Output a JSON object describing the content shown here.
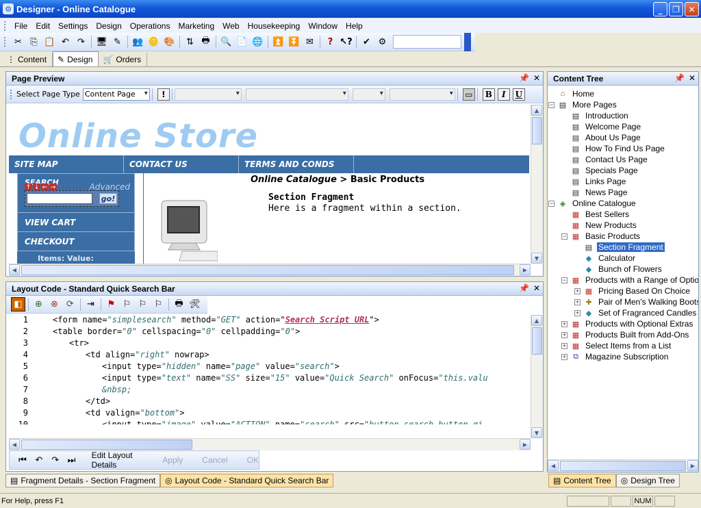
{
  "window": {
    "title": "Designer - Online Catalogue",
    "min": "_",
    "max": "❐",
    "close": "✕"
  },
  "menu": [
    "File",
    "Edit",
    "Settings",
    "Design",
    "Operations",
    "Marketing",
    "Web",
    "Housekeeping",
    "Window",
    "Help"
  ],
  "doc_tabs": {
    "content": "Content",
    "design": "Design",
    "orders": "Orders"
  },
  "page_preview": {
    "title": "Page Preview",
    "select_label": "Select Page Type",
    "page_type": "Content Page",
    "format_buttons": [
      "B",
      "I",
      "U"
    ],
    "store_title": "Online Store",
    "nav": [
      "SITE MAP",
      "CONTACT US",
      "TERMS AND CONDS"
    ],
    "search_label": "SEARCH",
    "advanced": "Advanced",
    "go": "go!",
    "side_items": [
      "VIEW CART",
      "CHECKOUT"
    ],
    "items_value": "Items:   Value:",
    "breadcrumb_root": "Online Catalogue",
    "breadcrumb_sep": ">",
    "breadcrumb_current": "Basic Products",
    "fragment_title": "Section Fragment",
    "fragment_text": "Here is a fragment within a section."
  },
  "layout_code": {
    "title": "Layout Code  - Standard Quick Search Bar",
    "lines": [
      {
        "n": "1",
        "indent": 0,
        "parts": [
          [
            "t",
            "<form name="
          ],
          [
            "v",
            "\"simplesearch\""
          ],
          [
            "t",
            " method="
          ],
          [
            "v",
            "\"GET\""
          ],
          [
            "t",
            " action=\""
          ],
          [
            "l",
            "Search Script URL"
          ],
          [
            "t",
            "\">"
          ]
        ]
      },
      {
        "n": "2",
        "indent": 0,
        "parts": [
          [
            "t",
            "<table border="
          ],
          [
            "v",
            "\"0\""
          ],
          [
            "t",
            " cellspacing="
          ],
          [
            "v",
            "\"0\""
          ],
          [
            "t",
            " cellpadding="
          ],
          [
            "v",
            "\"0\""
          ],
          [
            "t",
            ">"
          ]
        ]
      },
      {
        "n": "3",
        "indent": 2,
        "parts": [
          [
            "t",
            "<tr>"
          ]
        ]
      },
      {
        "n": "4",
        "indent": 4,
        "parts": [
          [
            "t",
            "<td align="
          ],
          [
            "v",
            "\"right\""
          ],
          [
            "t",
            " nowrap>"
          ]
        ]
      },
      {
        "n": "5",
        "indent": 6,
        "parts": [
          [
            "t",
            "<input type="
          ],
          [
            "v",
            "\"hidden\""
          ],
          [
            "t",
            " name="
          ],
          [
            "v",
            "\"page\""
          ],
          [
            "t",
            " value="
          ],
          [
            "v",
            "\"search\""
          ],
          [
            "t",
            ">"
          ]
        ]
      },
      {
        "n": "6",
        "indent": 6,
        "parts": [
          [
            "t",
            "<input type="
          ],
          [
            "v",
            "\"text\""
          ],
          [
            "t",
            " name="
          ],
          [
            "v",
            "\"SS\""
          ],
          [
            "t",
            " size="
          ],
          [
            "v",
            "\"15\""
          ],
          [
            "t",
            " value="
          ],
          [
            "v",
            "\"Quick Search\""
          ],
          [
            "t",
            " onFocus="
          ],
          [
            "v",
            "\"this.valu"
          ]
        ]
      },
      {
        "n": "7",
        "indent": 6,
        "parts": [
          [
            "v",
            "&nbsp;"
          ]
        ]
      },
      {
        "n": "8",
        "indent": 4,
        "parts": [
          [
            "t",
            "</td>"
          ]
        ]
      },
      {
        "n": "9",
        "indent": 4,
        "parts": [
          [
            "t",
            "<td valign="
          ],
          [
            "v",
            "\"bottom\""
          ],
          [
            "t",
            ">"
          ]
        ]
      },
      {
        "n": "10",
        "indent": 6,
        "parts": [
          [
            "t",
            "<input type="
          ],
          [
            "v",
            "\"image\""
          ],
          [
            "t",
            " value="
          ],
          [
            "v",
            "\"ACTION\""
          ],
          [
            "t",
            " name="
          ],
          [
            "v",
            "\"search\""
          ],
          [
            "t",
            " src="
          ],
          [
            "v",
            "\"button_search_button.gi"
          ]
        ]
      }
    ],
    "edit_label": "Edit Layout Details",
    "apply": "Apply",
    "cancel": "Cancel",
    "ok": "OK"
  },
  "bottom_tabs_left": [
    "Fragment Details - Section Fragment",
    "Layout Code  - Standard Quick Search Bar"
  ],
  "content_tree": {
    "title": "Content Tree",
    "items": [
      {
        "label": "Home",
        "level": 0,
        "exp": "",
        "icon": "home"
      },
      {
        "label": "More Pages",
        "level": 0,
        "exp": "−",
        "icon": "pages"
      },
      {
        "label": "Introduction",
        "level": 1,
        "exp": "",
        "icon": "page"
      },
      {
        "label": "Welcome Page",
        "level": 1,
        "exp": "",
        "icon": "page"
      },
      {
        "label": "About Us Page",
        "level": 1,
        "exp": "",
        "icon": "page"
      },
      {
        "label": "How To Find Us Page",
        "level": 1,
        "exp": "",
        "icon": "page"
      },
      {
        "label": "Contact Us Page",
        "level": 1,
        "exp": "",
        "icon": "page"
      },
      {
        "label": "Specials Page",
        "level": 1,
        "exp": "",
        "icon": "page"
      },
      {
        "label": "Links Page",
        "level": 1,
        "exp": "",
        "icon": "page"
      },
      {
        "label": "News Page",
        "level": 1,
        "exp": "",
        "icon": "page"
      },
      {
        "label": "Online Catalogue",
        "level": 0,
        "exp": "−",
        "icon": "catalogue"
      },
      {
        "label": "Best Sellers",
        "level": 1,
        "exp": "",
        "icon": "section"
      },
      {
        "label": "New Products",
        "level": 1,
        "exp": "",
        "icon": "section"
      },
      {
        "label": "Basic Products",
        "level": 1,
        "exp": "−",
        "icon": "section"
      },
      {
        "label": "Section Fragment",
        "level": 2,
        "exp": "",
        "icon": "page",
        "selected": true
      },
      {
        "label": "Calculator",
        "level": 2,
        "exp": "",
        "icon": "product"
      },
      {
        "label": "Bunch of Flowers",
        "level": 2,
        "exp": "",
        "icon": "product"
      },
      {
        "label": "Products with a Range of Options",
        "level": 1,
        "exp": "−",
        "icon": "section"
      },
      {
        "label": "Pricing Based On Choice",
        "level": 2,
        "exp": "+",
        "icon": "section"
      },
      {
        "label": "Pair of Men's Walking Boots",
        "level": 2,
        "exp": "+",
        "icon": "options"
      },
      {
        "label": "Set of Fragranced Candles",
        "level": 2,
        "exp": "+",
        "icon": "product"
      },
      {
        "label": "Products with Optional Extras",
        "level": 1,
        "exp": "+",
        "icon": "section"
      },
      {
        "label": "Products Built from Add-Ons",
        "level": 1,
        "exp": "+",
        "icon": "section"
      },
      {
        "label": "Select Items from a List",
        "level": 1,
        "exp": "+",
        "icon": "section"
      },
      {
        "label": "Magazine Subscription",
        "level": 1,
        "exp": "+",
        "icon": "subscription"
      }
    ]
  },
  "bottom_tabs_right": [
    "Content Tree",
    "Design Tree"
  ],
  "status": {
    "help": "For Help, press F1",
    "num": "NUM"
  }
}
